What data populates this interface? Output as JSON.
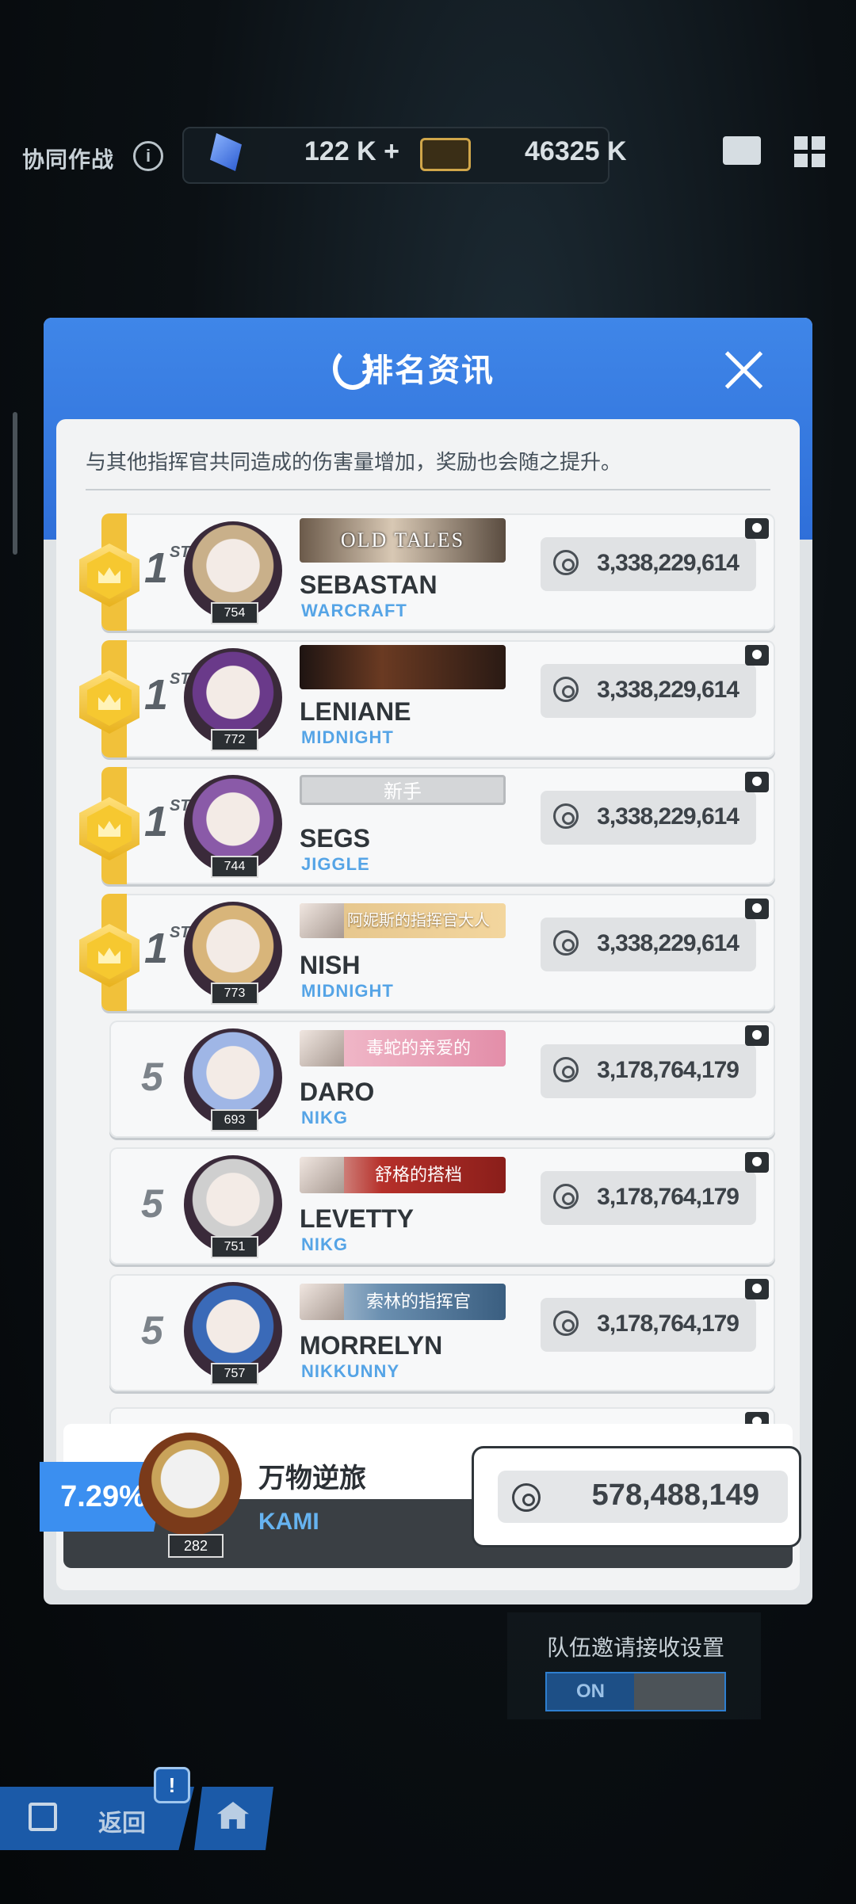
{
  "topbar": {
    "title": "协同作战",
    "resource1": "122 K +",
    "resource2": "46325 K"
  },
  "panel": {
    "title": "排名资讯",
    "description": "与其他指挥官共同造成的伤害量增加，奖励也会随之提升。"
  },
  "rankings": [
    {
      "rank": "1",
      "suffix": "ST",
      "level": "754",
      "banner": "OLD TALES",
      "banner_style": "b-old",
      "name": "SEBASTAN",
      "guild": "WARCRAFT",
      "score": "3,338,229,614"
    },
    {
      "rank": "1",
      "suffix": "ST",
      "level": "772",
      "banner": "",
      "banner_style": "b-dark",
      "name": "LENIANE",
      "guild": "MIDNIGHT",
      "score": "3,338,229,614"
    },
    {
      "rank": "1",
      "suffix": "ST",
      "level": "744",
      "banner": "新手",
      "banner_style": "b-plain",
      "name": "SEGS",
      "guild": "JIGGLE",
      "score": "3,338,229,614"
    },
    {
      "rank": "1",
      "suffix": "ST",
      "level": "773",
      "banner": "阿妮斯的指挥官大人",
      "banner_style": "b-gold",
      "name": "NISH",
      "guild": "MIDNIGHT",
      "score": "3,338,229,614"
    },
    {
      "rank": "5",
      "suffix": "",
      "level": "693",
      "banner": "毒蛇的亲爱的",
      "banner_style": "b-pink",
      "name": "DARO",
      "guild": "NIKG",
      "score": "3,178,764,179"
    },
    {
      "rank": "5",
      "suffix": "",
      "level": "751",
      "banner": "舒格的搭档",
      "banner_style": "b-red",
      "name": "LEVETTY",
      "guild": "NIKG",
      "score": "3,178,764,179"
    },
    {
      "rank": "5",
      "suffix": "",
      "level": "757",
      "banner": "索林的指挥官",
      "banner_style": "b-blue",
      "name": "MORRELYN",
      "guild": "NIKKUNNY",
      "score": "3,178,764,179"
    }
  ],
  "me": {
    "percent": "7.29%",
    "level": "282",
    "name": "万物逆旅",
    "guild": "KAMI",
    "score": "578,488,149"
  },
  "invite": {
    "label": "队伍邀请接收设置",
    "toggle_on": "ON"
  },
  "nav": {
    "back_label": "返回",
    "alert": "!"
  },
  "colors": {
    "panel_blue": "#3f86e8",
    "gold": "#f1c13a",
    "guild_blue": "#55a4e6",
    "percent_blue": "#3b8ff0"
  }
}
